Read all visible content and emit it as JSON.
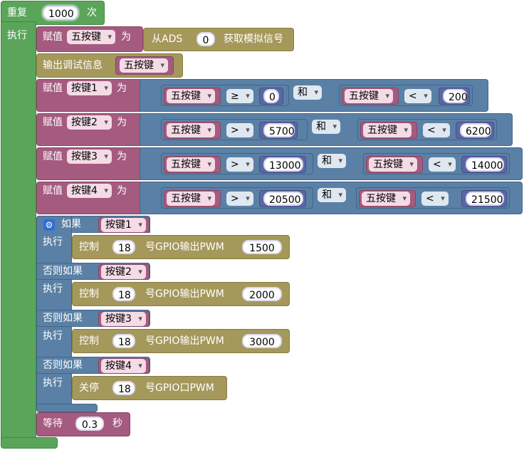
{
  "repeat": {
    "label": "重复",
    "count": "1000",
    "unit": "次",
    "do": "执行"
  },
  "assign_ads": {
    "set": "赋值",
    "var": "五按键",
    "to": "为",
    "from": "从ADS",
    "channel": "0",
    "read": "获取模拟信号"
  },
  "debug": {
    "label": "输出调试信息",
    "var": "五按键"
  },
  "common": {
    "set": "赋值",
    "to": "为",
    "and": "和",
    "five": "五按键"
  },
  "assigns": [
    {
      "var": "按键1",
      "op1": "≥",
      "v1": "0",
      "op2": "<",
      "v2": "200"
    },
    {
      "var": "按键2",
      "op1": ">",
      "v1": "5700",
      "op2": "<",
      "v2": "6200"
    },
    {
      "var": "按键3",
      "op1": ">",
      "v1": "13000",
      "op2": "<",
      "v2": "14000"
    },
    {
      "var": "按键4",
      "op1": ">",
      "v1": "20500",
      "op2": "<",
      "v2": "21500"
    }
  ],
  "ifblock": {
    "if": "如果",
    "elseif": "否则如果",
    "do": "执行",
    "control": "控制",
    "gpio_pwm": "号GPIO输出PWM",
    "stop": "关停",
    "stop_pwm": "号GPIO口PWM",
    "branches": [
      {
        "cond": "按键1",
        "pin": "18",
        "value": "1500"
      },
      {
        "cond": "按键2",
        "pin": "18",
        "value": "2000"
      },
      {
        "cond": "按键3",
        "pin": "18",
        "value": "3000"
      },
      {
        "cond": "按键4",
        "pin": "18"
      }
    ]
  },
  "wait": {
    "label": "等待",
    "value": "0.3",
    "unit": "秒"
  }
}
